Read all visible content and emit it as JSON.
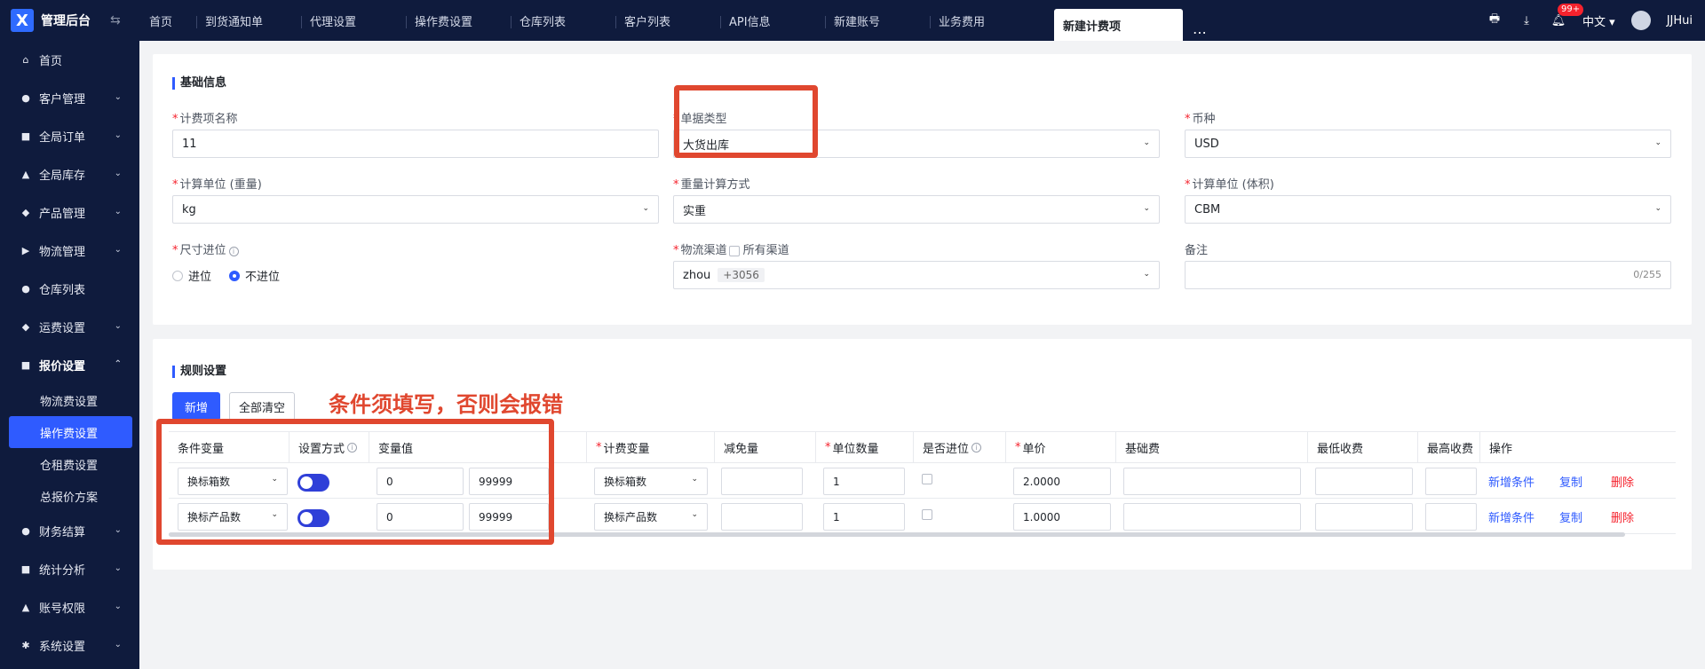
{
  "header": {
    "app_title": "管理后台",
    "tabs": [
      "首页",
      "到货通知单",
      "代理设置",
      "操作费设置",
      "仓库列表",
      "客户列表",
      "API信息",
      "新建账号",
      "业务费用",
      "新建计费项"
    ],
    "active_tab": "新建计费项",
    "notification_count": "99+",
    "language": "中文",
    "username": "JJHui"
  },
  "sidebar": {
    "items": [
      {
        "label": "首页",
        "icon": "home-icon",
        "has_children": false
      },
      {
        "label": "客户管理",
        "icon": "users-icon",
        "has_children": true
      },
      {
        "label": "全局订单",
        "icon": "clipboard-icon",
        "has_children": true
      },
      {
        "label": "全局库存",
        "icon": "warehouse-icon",
        "has_children": true
      },
      {
        "label": "产品管理",
        "icon": "box-icon",
        "has_children": true
      },
      {
        "label": "物流管理",
        "icon": "truck-icon",
        "has_children": true
      },
      {
        "label": "仓库列表",
        "icon": "store-icon",
        "has_children": false
      },
      {
        "label": "运费设置",
        "icon": "shipping-icon",
        "has_children": true
      },
      {
        "label": "报价设置",
        "icon": "document-icon",
        "has_children": true,
        "open": true
      },
      {
        "label": "财务结算",
        "icon": "finance-icon",
        "has_children": true
      },
      {
        "label": "统计分析",
        "icon": "chart-icon",
        "has_children": true
      },
      {
        "label": "账号权限",
        "icon": "org-icon",
        "has_children": true
      },
      {
        "label": "系统设置",
        "icon": "settings-icon",
        "has_children": true
      }
    ],
    "quote_sub_items": [
      "物流费设置",
      "操作费设置",
      "仓租费设置",
      "总报价方案"
    ],
    "active_sub_item": "操作费设置"
  },
  "basic_info": {
    "title": "基础信息",
    "fee_name_label": "计费项名称",
    "fee_name_value": "11",
    "doc_type_label": "单据类型",
    "doc_type_value": "大货出库",
    "currency_label": "币种",
    "currency_value": "USD",
    "weight_unit_label": "计算单位 (重量)",
    "weight_unit_value": "kg",
    "weight_calc_label": "重量计算方式",
    "weight_calc_value": "实重",
    "volume_unit_label": "计算单位 (体积)",
    "volume_unit_value": "CBM",
    "size_round_label": "尺寸进位",
    "radio_round": "进位",
    "radio_no_round": "不进位",
    "logistics_label": "物流渠道",
    "all_channels_label": "所有渠道",
    "logistics_value": "zhou",
    "logistics_more": "+3056",
    "remark_label": "备注",
    "remark_counter": "0/255"
  },
  "rules": {
    "title": "规则设置",
    "add_button": "新增",
    "clear_button": "全部清空",
    "annotation": "条件须填写，否则会报错",
    "columns": [
      "条件变量",
      "设置方式",
      "变量值",
      "计费变量",
      "减免量",
      "单位数量",
      "是否进位",
      "单价",
      "基础费",
      "最低收费",
      "最高收费",
      "操作"
    ],
    "required_columns": [
      "计费变量",
      "单位数量",
      "单价"
    ],
    "rows": [
      {
        "condition_var": "换标箱数",
        "min": "0",
        "max": "99999",
        "charge_var": "换标箱数",
        "unit_qty": "1",
        "price": "2.0000"
      },
      {
        "condition_var": "换标产品数",
        "min": "0",
        "max": "99999",
        "charge_var": "换标产品数",
        "unit_qty": "1",
        "price": "1.0000"
      }
    ],
    "ops": {
      "add_condition": "新增条件",
      "copy": "复制",
      "delete": "删除"
    }
  },
  "colors": {
    "accent": "#2f5bff",
    "nav_bg": "#0f1b3d",
    "annotation": "#e0472f",
    "danger": "#f5222d"
  }
}
